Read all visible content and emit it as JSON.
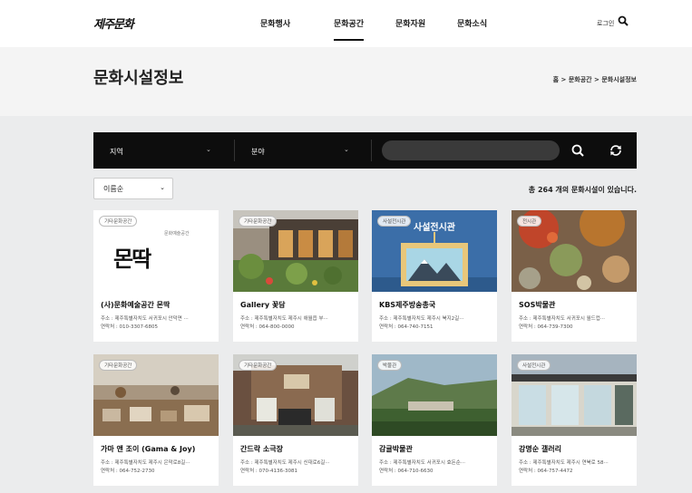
{
  "header": {
    "logo": "제주문화",
    "nav": [
      "문화행사",
      "문화공간",
      "문화자원",
      "문화소식"
    ],
    "active_nav": 1,
    "login": "로그인"
  },
  "title_area": {
    "title": "문화시설정보",
    "breadcrumb": "홈 > 문화공간 > 문화시설정보"
  },
  "filters": {
    "region_label": "지역",
    "field_label": "분야",
    "search_placeholder": ""
  },
  "sort": {
    "selected": "이름순"
  },
  "result_count": "총 264 개의 문화시설이 있습니다.",
  "cards": [
    {
      "badge": "기타문화공간",
      "name": "(사)문화예술공간 몬딱",
      "addr": "주소 : 제주특별자치도 서귀포시 안덕면 ···",
      "tel": "연락처 : 010-3307-6805",
      "logo_text": "몬딱"
    },
    {
      "badge": "기타문화공간",
      "name": "Gallery 꽃담",
      "addr": "주소 : 제주특별자치도 제주시 애월읍 부···",
      "tel": "연락처 : 064-800-0000"
    },
    {
      "badge": "사설전시관",
      "name": "KBS제주방송총국",
      "addr": "주소 : 제주특별자치도 제주시 북지2길···",
      "tel": "연락처 : 064-740-7151",
      "thumb_text": "사설전시관"
    },
    {
      "badge": "전시관",
      "name": "SOS박물관",
      "addr": "주소 : 제주특별자치도 서귀포시 월드컵···",
      "tel": "연락처 : 064-739-7300"
    },
    {
      "badge": "기타문화공간",
      "name": "가마 앤 조이 (Gama & Joy)",
      "addr": "주소 : 제주특별자치도 제주시 은막로8길···",
      "tel": "연락처 : 064-752-2730"
    },
    {
      "badge": "기타문화공간",
      "name": "간드락 소극장",
      "addr": "주소 : 제주특별자치도 제주시 신대로6길···",
      "tel": "연락처 : 070-4136-3081"
    },
    {
      "badge": "박물관",
      "name": "감귤박물관",
      "addr": "주소 : 제주특별자치도 서귀포시 효돈순···",
      "tel": "연락처 : 064-710-6630"
    },
    {
      "badge": "사설전시관",
      "name": "강명순 갤러리",
      "addr": "주소 : 제주특별자치도 제주시 연북로 58···",
      "tel": "연락처 : 064-757-4472"
    }
  ]
}
